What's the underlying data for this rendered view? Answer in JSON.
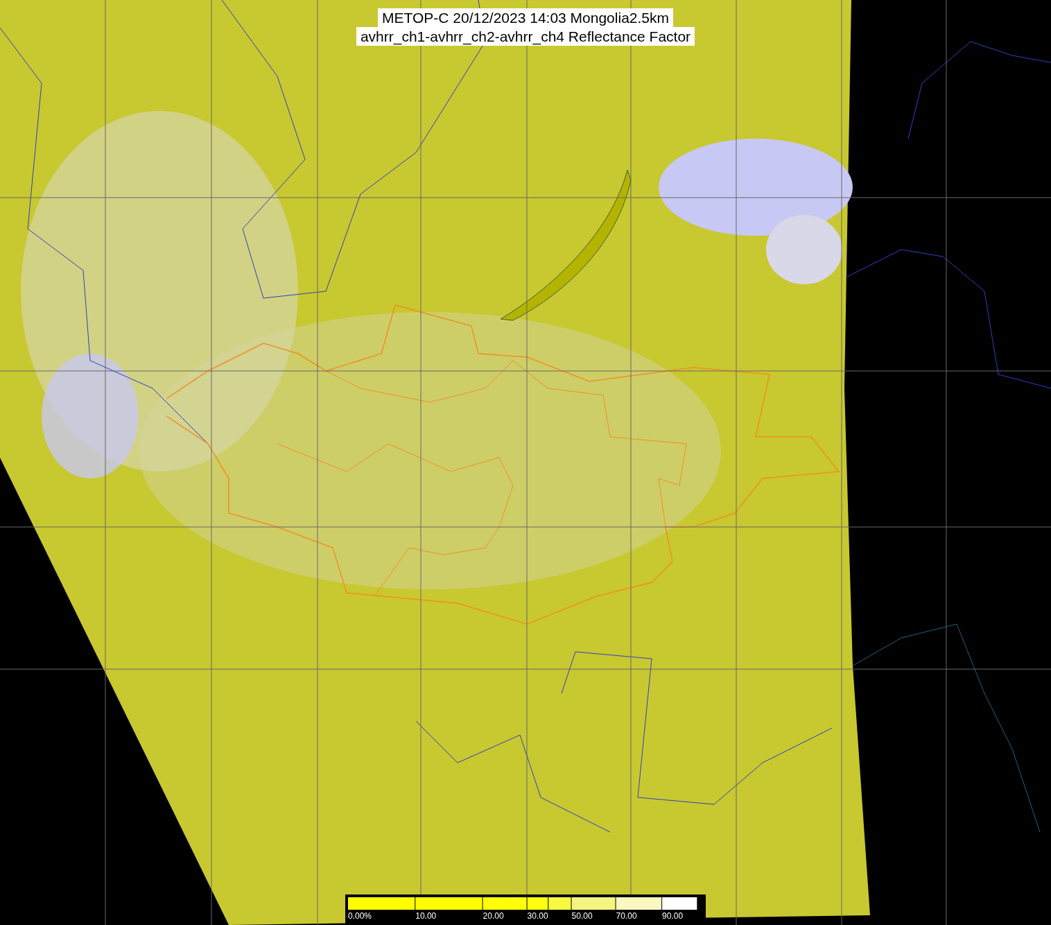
{
  "title": {
    "lines": [
      "METOP-C 20/12/2023 14:03 Mongolia2.5km",
      "avhrr_ch1-avhrr_ch2-avhrr_ch4 Reflectance Factor"
    ]
  },
  "colorbar": {
    "segments": [
      {
        "color": "#ffff00"
      },
      {
        "color": "#ffff00"
      },
      {
        "color": "#ffff08"
      },
      {
        "color": "#ffff10"
      },
      {
        "color": "#f8f840"
      },
      {
        "color": "#f4f480"
      },
      {
        "color": "#f8f8c0"
      },
      {
        "color": "#ffffff"
      }
    ],
    "labels": [
      "0.00%",
      "10.00",
      "20.00",
      "30.00",
      "50.00",
      "70.00",
      "90.00"
    ]
  }
}
